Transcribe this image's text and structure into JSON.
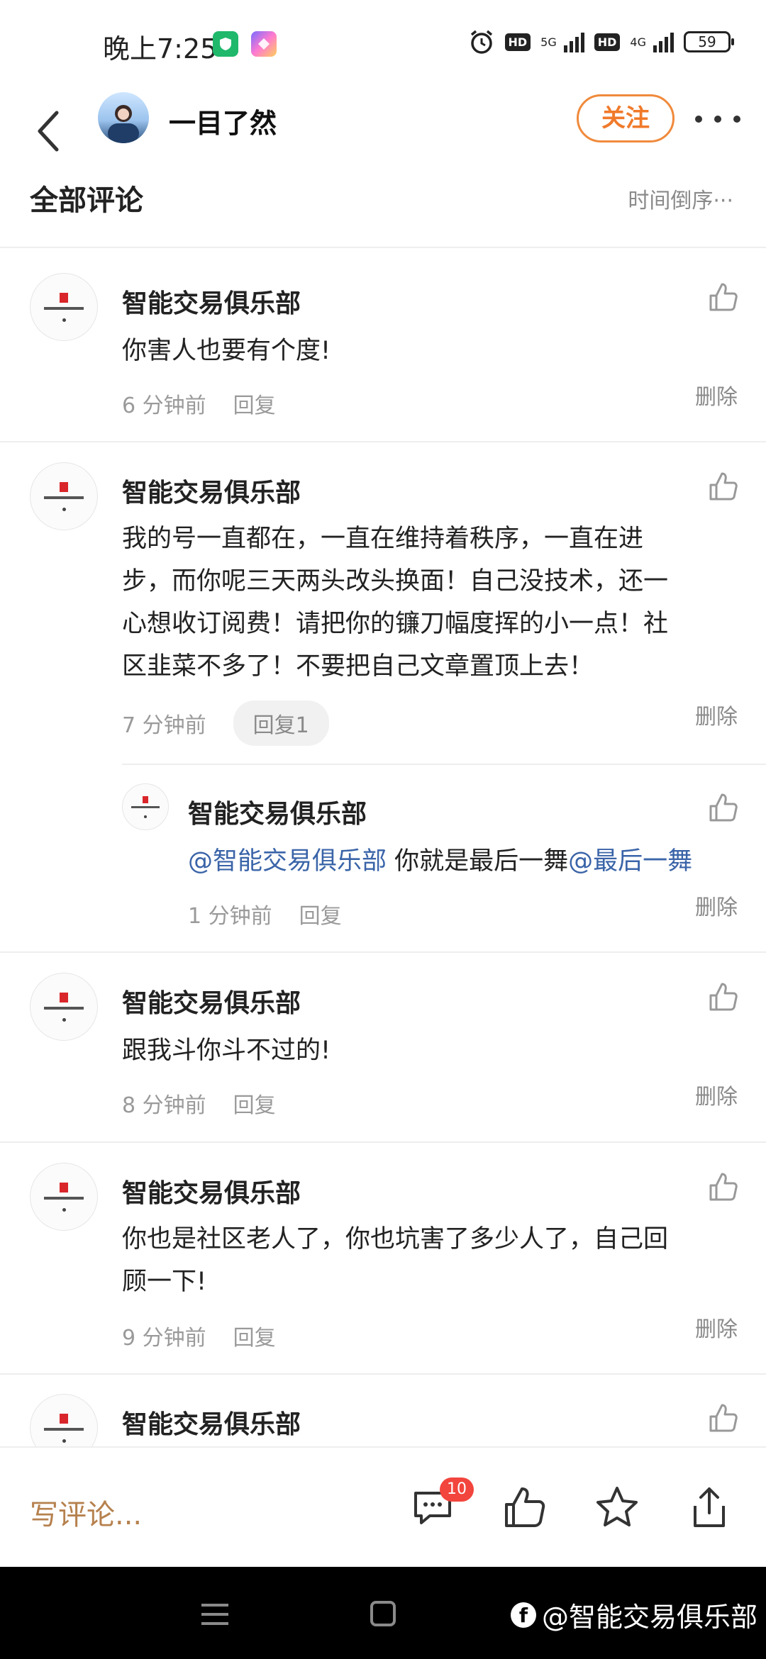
{
  "status_bar": {
    "time": "晚上7:25",
    "net1": "5G",
    "net2": "4G",
    "hd": "HD",
    "battery": "59"
  },
  "header": {
    "username": "一目了然",
    "follow_label": "关注"
  },
  "comments_section": {
    "title": "全部评论",
    "sort_label": "时间倒序",
    "sort_more": "···"
  },
  "comments": [
    {
      "author": "智能交易俱乐部",
      "text": "你害人也要有个度!",
      "time": "6 分钟前",
      "reply_label": "回复",
      "delete_label": "删除"
    },
    {
      "author": "智能交易俱乐部",
      "text_lines": [
        "我的号一直都在，一直在维持着秩序，一直在进",
        "步，而你呢三天两头改头换面！自己没技术，还一",
        "心想收订阅费！请把你的镰刀幅度挥的小一点！社",
        "区韭菜不多了！不要把自己文章置顶上去！"
      ],
      "time": "7 分钟前",
      "reply_label": "回复1",
      "delete_label": "删除",
      "reply": {
        "author": "智能交易俱乐部",
        "mention1": "@智能交易俱乐部",
        "text": " 你就是最后一舞",
        "mention2": "@最后一舞",
        "time": "1 分钟前",
        "reply_label": "回复",
        "delete_label": "删除"
      }
    },
    {
      "author": "智能交易俱乐部",
      "text": "跟我斗你斗不过的!",
      "time": "8 分钟前",
      "reply_label": "回复",
      "delete_label": "删除"
    },
    {
      "author": "智能交易俱乐部",
      "text_lines": [
        "你也是社区老人了，你也坑害了多少人了，自己回",
        "顾一下!"
      ],
      "time": "9 分钟前",
      "reply_label": "回复",
      "delete_label": "删除"
    },
    {
      "author": "智能交易俱乐部"
    }
  ],
  "bottom_bar": {
    "write_comment": "写评论...",
    "comment_count": "10"
  },
  "watermark": "@智能交易俱乐部",
  "icons": {
    "back": "back-arrow-icon",
    "more": "more-dots-icon",
    "like": "thumbs-up-icon",
    "comment": "comment-bubble-icon",
    "star": "star-icon",
    "share": "share-icon"
  },
  "colors": {
    "follow_accent": "#f07a2a",
    "mention": "#3a64a8",
    "badge": "#f2453d",
    "write_comment": "#b6814e"
  }
}
